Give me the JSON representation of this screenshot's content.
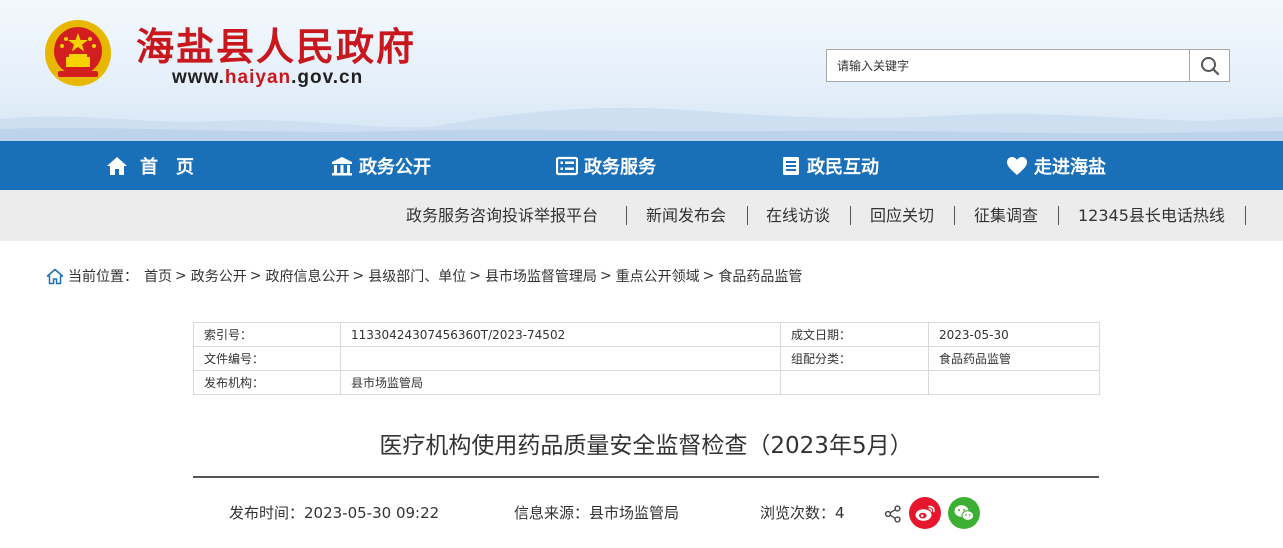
{
  "header": {
    "site_title": "海盐县人民政府",
    "url_prefix": "www.",
    "url_highlight": "haiyan",
    "url_suffix": ".gov.cn",
    "search_placeholder": "请输入关键字"
  },
  "nav": {
    "items": [
      {
        "label": "首　页",
        "icon": "home-icon"
      },
      {
        "label": "政务公开",
        "icon": "building-icon"
      },
      {
        "label": "政务服务",
        "icon": "list-icon"
      },
      {
        "label": "政民互动",
        "icon": "document-icon"
      },
      {
        "label": "走进海盐",
        "icon": "heart-icon"
      }
    ]
  },
  "subnav": {
    "items": [
      "政务服务咨询投诉举报平台",
      "新闻发布会",
      "在线访谈",
      "回应关切",
      "征集调查",
      "12345县长电话热线"
    ]
  },
  "breadcrumb": {
    "prefix": "当前位置：",
    "items": [
      "首页",
      "政务公开",
      "政府信息公开",
      "县级部门、单位",
      "县市场监督管理局",
      "重点公开领域",
      "食品药品监管"
    ],
    "separator": ">"
  },
  "info_table": {
    "rows": [
      {
        "label1": "索引号：",
        "value1": "11330424307456360T/2023-74502",
        "label2": "成文日期：",
        "value2": "2023-05-30"
      },
      {
        "label1": "文件编号：",
        "value1": "",
        "label2": "组配分类：",
        "value2": "食品药品监管"
      },
      {
        "label1": "发布机构：",
        "value1": "县市场监管局",
        "label2": "",
        "value2": ""
      }
    ]
  },
  "article": {
    "title": "医疗机构使用药品质量安全监督检查（2023年5月）",
    "publish_time": "发布时间：2023-05-30 09:22",
    "source": "信息来源：县市场监管局",
    "views": "浏览次数：4"
  },
  "colors": {
    "brand_red": "#c9171e",
    "nav_blue": "#1a6fb9",
    "weibo_red": "#e6162d",
    "wechat_green": "#3cb034"
  }
}
